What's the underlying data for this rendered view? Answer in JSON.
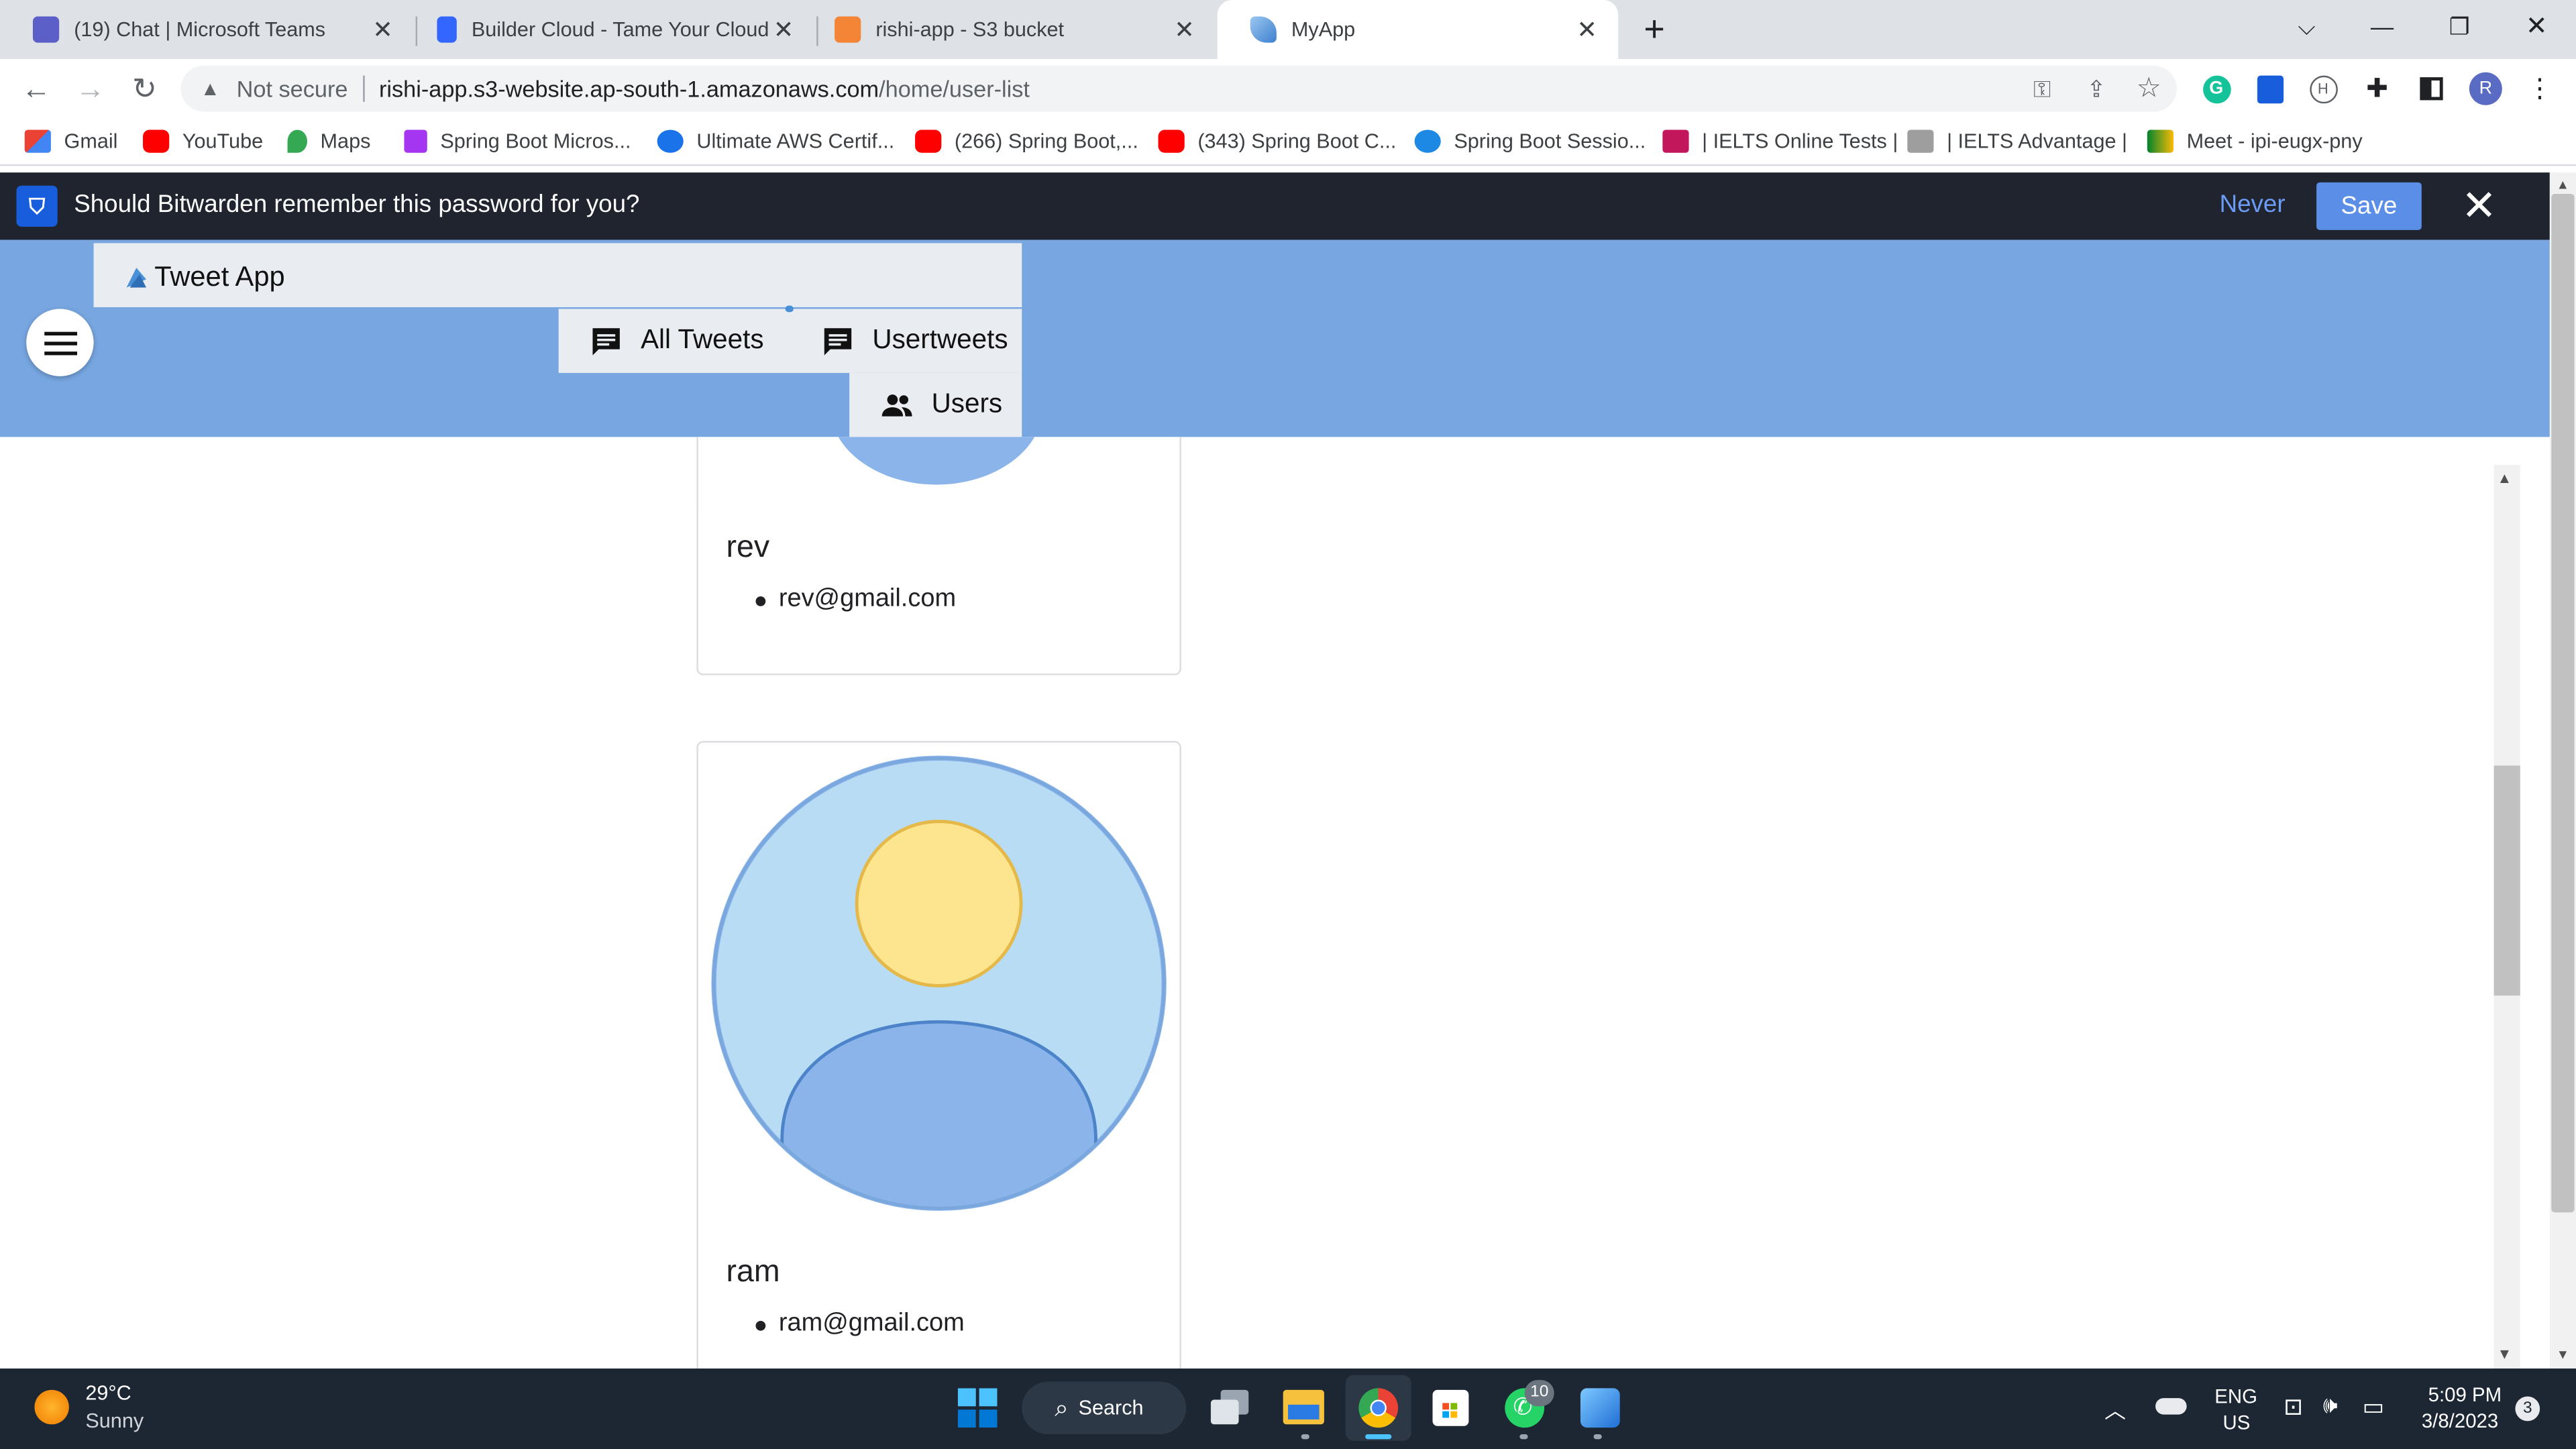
{
  "browser": {
    "tabs": [
      {
        "title": "(19) Chat | Microsoft Teams",
        "active": false,
        "icon": "teams-icon",
        "color": "#5b5fc7"
      },
      {
        "title": "Builder Cloud - Tame Your Cloud",
        "active": false,
        "icon": "builder-icon",
        "color": "#3366ff"
      },
      {
        "title": "rishi-app - S3 bucket",
        "active": false,
        "icon": "aws-cube-icon",
        "color": "#f58536"
      },
      {
        "title": "MyApp",
        "active": true,
        "icon": "myapp-icon",
        "color": "#4a90d9"
      }
    ],
    "address": {
      "security_label": "Not secure",
      "host": "rishi-app.s3-website.ap-south-1.amazonaws.com",
      "path": "/home/user-list"
    },
    "profile_initial": "R",
    "bookmarks": [
      {
        "label": "Gmail",
        "icon": "gmail-icon"
      },
      {
        "label": "YouTube",
        "icon": "youtube-icon"
      },
      {
        "label": "Maps",
        "icon": "maps-icon"
      },
      {
        "label": "Spring Boot Micros...",
        "icon": "udemy-icon"
      },
      {
        "label": "Ultimate AWS Certif...",
        "icon": "aws-course-icon"
      },
      {
        "label": "(266) Spring Boot,...",
        "icon": "youtube-icon"
      },
      {
        "label": "(343) Spring Boot C...",
        "icon": "youtube-icon"
      },
      {
        "label": "Spring Boot Sessio...",
        "icon": "session-icon"
      },
      {
        "label": "| IELTS Online Tests |",
        "icon": "ielts-icon"
      },
      {
        "label": "| IELTS Advantage |",
        "icon": "ielts-advantage-icon"
      },
      {
        "label": "Meet - ipi-eugx-pny",
        "icon": "meet-icon"
      }
    ]
  },
  "bitwarden": {
    "prompt": "Should Bitwarden remember this password for you?",
    "never_label": "Never",
    "save_label": "Save"
  },
  "app": {
    "brand": "Tweet App",
    "nav": {
      "all_tweets": "All Tweets",
      "user_tweets": "Usertweets",
      "users": "Users"
    },
    "users": [
      {
        "name": "rev",
        "email": "rev@gmail.com"
      },
      {
        "name": "ram",
        "email": "ram@gmail.com"
      }
    ]
  },
  "taskbar": {
    "weather_temp": "29°C",
    "weather_desc": "Sunny",
    "search_label": "Search",
    "whatsapp_badge": "10",
    "lang_line1": "ENG",
    "lang_line2": "US",
    "time": "5:09 PM",
    "date": "3/8/2023",
    "notification_count": "3"
  }
}
